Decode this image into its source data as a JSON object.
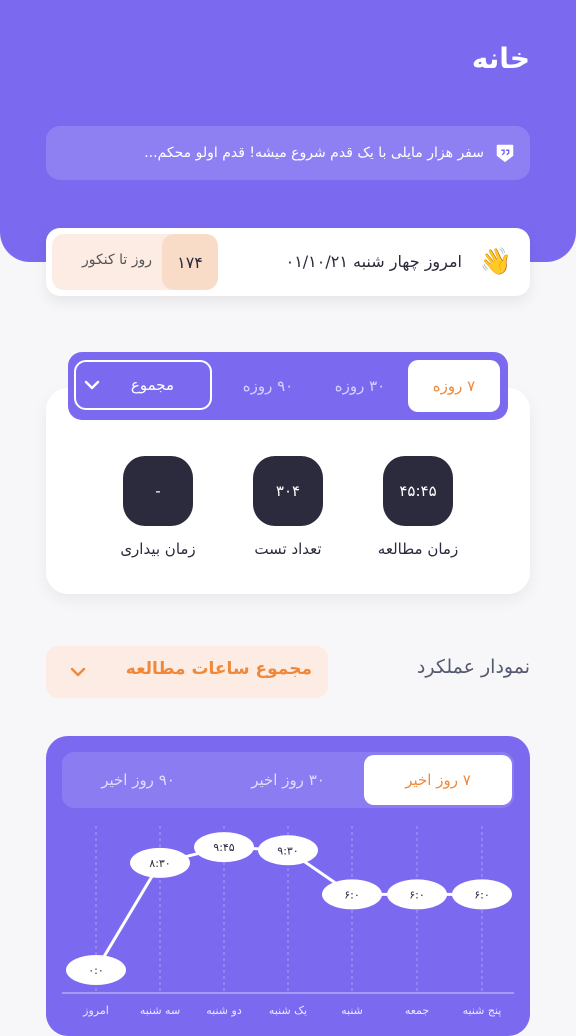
{
  "header": {
    "title": "خانه"
  },
  "quote": {
    "icon": "quote-shield-icon",
    "text": "سفر هزار مایلی با یک قدم شروع میشه! قدم اولو محکم..."
  },
  "today": {
    "icon": "waving-hand-icon",
    "emoji": "👋",
    "date_text": "امروز چهار شنبه ۰۱/۱۰/۲۱",
    "konkur_days": "۱۷۴",
    "konkur_label": "روز تا کنکور"
  },
  "range": {
    "tabs": [
      "۷ روزه",
      "۳۰ روزه",
      "۹۰ روزه"
    ],
    "active": 0,
    "select_value": "مجموع"
  },
  "stats": [
    {
      "value": "۴۵:۴۵",
      "label": "زمان مطالعه"
    },
    {
      "value": "۳۰۴",
      "label": "تعداد تست"
    },
    {
      "value": "-",
      "label": "زمان بیداری"
    }
  ],
  "performance": {
    "title": "نمودار عملکرد",
    "select_value": "مجموع ساعات مطالعه",
    "tabs": [
      "۷ روز اخیر",
      "۳۰ روز اخیر",
      "۹۰ روز اخیر"
    ],
    "active": 0
  },
  "colors": {
    "primary": "#7b6af0",
    "accent": "#f0883a",
    "dark": "#2b2b3d",
    "soft_orange": "#fdece3"
  },
  "chart_data": {
    "type": "line",
    "x": [
      "امروز",
      "سه شنبه",
      "دو شنبه",
      "یک شنبه",
      "شنبه",
      "جمعه",
      "پنج شنبه"
    ],
    "labels": [
      "۰:۰",
      "۸:۳۰",
      "۹:۴۵",
      "۹:۳۰",
      "۶:۰",
      "۶:۰",
      "۶:۰"
    ],
    "values": [
      0,
      8.5,
      9.75,
      9.5,
      6,
      6,
      6
    ],
    "ylim": [
      0,
      10
    ]
  }
}
